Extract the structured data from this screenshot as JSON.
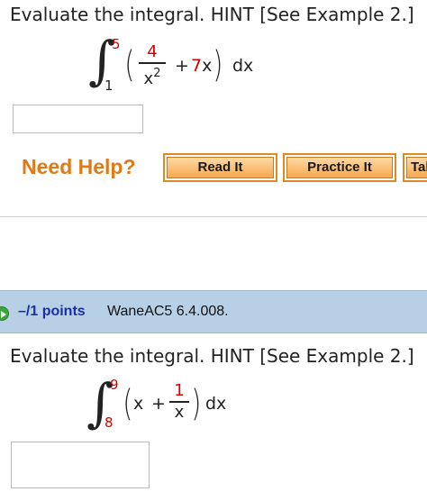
{
  "problem1": {
    "prompt": "Evaluate the integral. HINT [See Example 2.]",
    "integral": {
      "upper": "5",
      "lower": "1",
      "frac_num": "4",
      "frac_den": "x",
      "frac_den_exp": "2",
      "plus": "+",
      "term_coef": "7",
      "term_var": "x",
      "differential": "dx"
    },
    "answer_value": ""
  },
  "help": {
    "label": "Need Help?",
    "buttons": [
      "Read It",
      "Practice It",
      "Talk to a Tutor"
    ]
  },
  "problem2": {
    "points": "–/1 points",
    "code": "WaneAC5 6.4.008.",
    "prompt": "Evaluate the integral. HINT [See Example 2.]",
    "integral": {
      "upper": "9",
      "lower": "8",
      "term_var": "x",
      "plus": "+",
      "frac_num": "1",
      "frac_den": "x",
      "differential": "dx"
    },
    "answer_value": ""
  },
  "colors": {
    "accent_orange": "#e07a18",
    "points_blue": "#1a2fa8",
    "bar_blue": "#b8d0e6",
    "red_value": "#d40000"
  }
}
